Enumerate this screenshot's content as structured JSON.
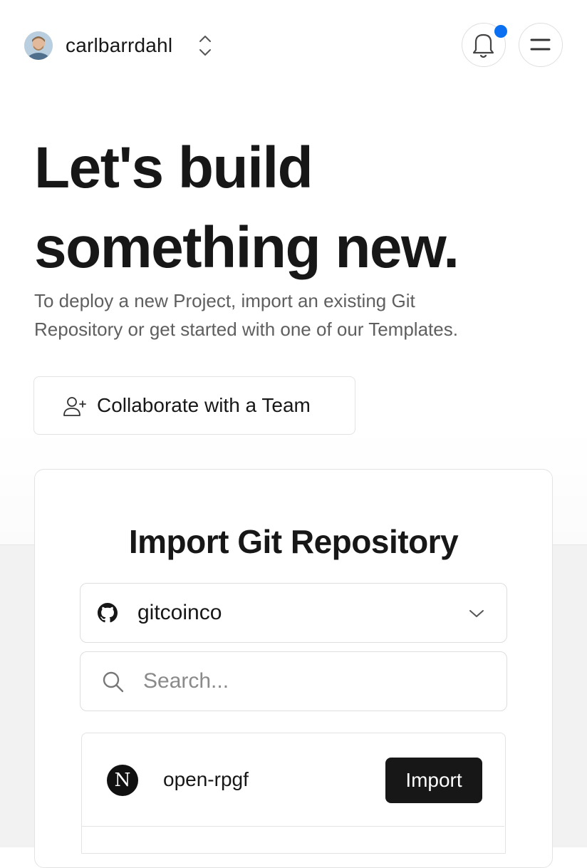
{
  "header": {
    "username": "carlbarrdahl",
    "notification_color": "#0a6ff0"
  },
  "hero": {
    "title_line1": "Let's build",
    "title_line2": "something new.",
    "subtitle_line1": "To deploy a new Project, import an existing Git",
    "subtitle_line2": "Repository or get started with one of our Templates."
  },
  "collab": {
    "label": "Collaborate with a Team",
    "icon": "user-plus-icon"
  },
  "import": {
    "title": "Import Git Repository",
    "account_select": {
      "value": "gitcoinco",
      "icon": "github-icon"
    },
    "search": {
      "placeholder": "Search..."
    },
    "repos": [
      {
        "name": "open-rpgf",
        "logo_letter": "N",
        "action_label": "Import"
      }
    ]
  }
}
